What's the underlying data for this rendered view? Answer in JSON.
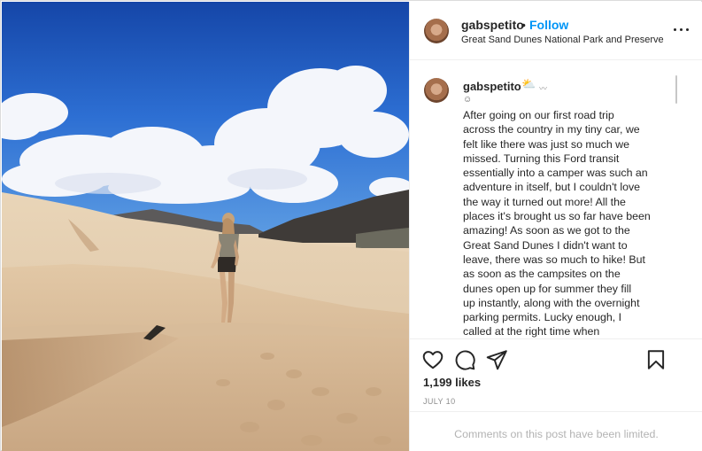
{
  "header": {
    "username": "gabspetito",
    "separator": "•",
    "follow_label": "Follow",
    "location": "Great Sand Dunes National Park and Preserve",
    "more_icon": "more-horizontal-icon"
  },
  "caption": {
    "username": "gabspetito",
    "emoji_sun_cloud": "⛅",
    "emoji_small": "〰",
    "emoji_smile": "☺",
    "lines": [
      "After going on our first road trip",
      "across the country in my tiny car, we",
      "felt like there was just so much we",
      "missed. Turning this Ford transit",
      "essentially into a camper was such an",
      "adventure in itself, but I couldn't love",
      "the way it turned out more! All the",
      "places it's brought us so far have been",
      "amazing! As soon as we got to the",
      "Great Sand Dunes I didn't want to",
      "leave, there was so much to hike! But",
      "as soon as the campsites on the",
      "dunes open up for summer they fill",
      "up instantly, along with the overnight",
      "parking permits. Lucky enough, I",
      "called at the right time when"
    ]
  },
  "actions": {
    "icons": [
      "heart-icon",
      "comment-icon",
      "share-icon",
      "bookmark-icon"
    ],
    "likes": "1,199 likes",
    "date": "JULY 10"
  },
  "comments": {
    "notice": "Comments on this post have been limited."
  },
  "colors": {
    "link": "#0095f6",
    "text": "#262626",
    "muted": "#8e8e8e",
    "border": "#efefef"
  }
}
